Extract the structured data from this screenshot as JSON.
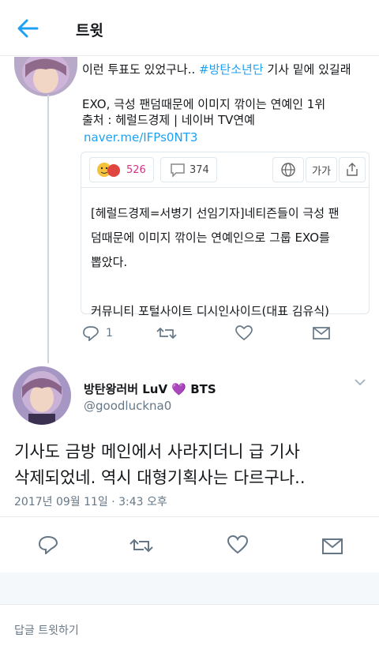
{
  "header": {
    "title": "트윗"
  },
  "quoted_tweet": {
    "line1_pre": "이런 투표도 있었구나.. ",
    "line1_tag": "#방탄소년단",
    "line1_post": " 기사 밑에 있길래",
    "line2": "EXO, 극성 팬덤때문에 이미지 깎이는 연예인 1위",
    "line3": "출처 : 헤럴드경제 | 네이버 TV연예",
    "link": "naver.me/IFPs0NT3",
    "card": {
      "reactions_count": "526",
      "comments_count": "374",
      "font_label": "가가",
      "body_lines": [
        "[헤럴드경제=서병기 선임기자]네티즌들이 극성 팬",
        "덤때문에 이미지 깎이는 연예인으로 그룹 EXO를",
        "뽑았다.",
        "",
        "커뮤니티 포털사이트 디시인사이드(대표 김유식)"
      ]
    },
    "reply_count": "1"
  },
  "main_tweet": {
    "name": "방탄왕러버 LuV 💜 BTS",
    "handle": "@goodluckna0",
    "text_line1": "기사도 금방 메인에서 사라지더니 급 기사",
    "text_line2": "삭제되었네. 역시 대형기획사는 다르구나..",
    "timestamp": "2017년 09월 11일 · 3:43 오후"
  },
  "reply_placeholder": "답글 트윗하기",
  "colors": {
    "accent": "#1da1f2",
    "muted": "#657786",
    "tag": "#1da1f2"
  }
}
